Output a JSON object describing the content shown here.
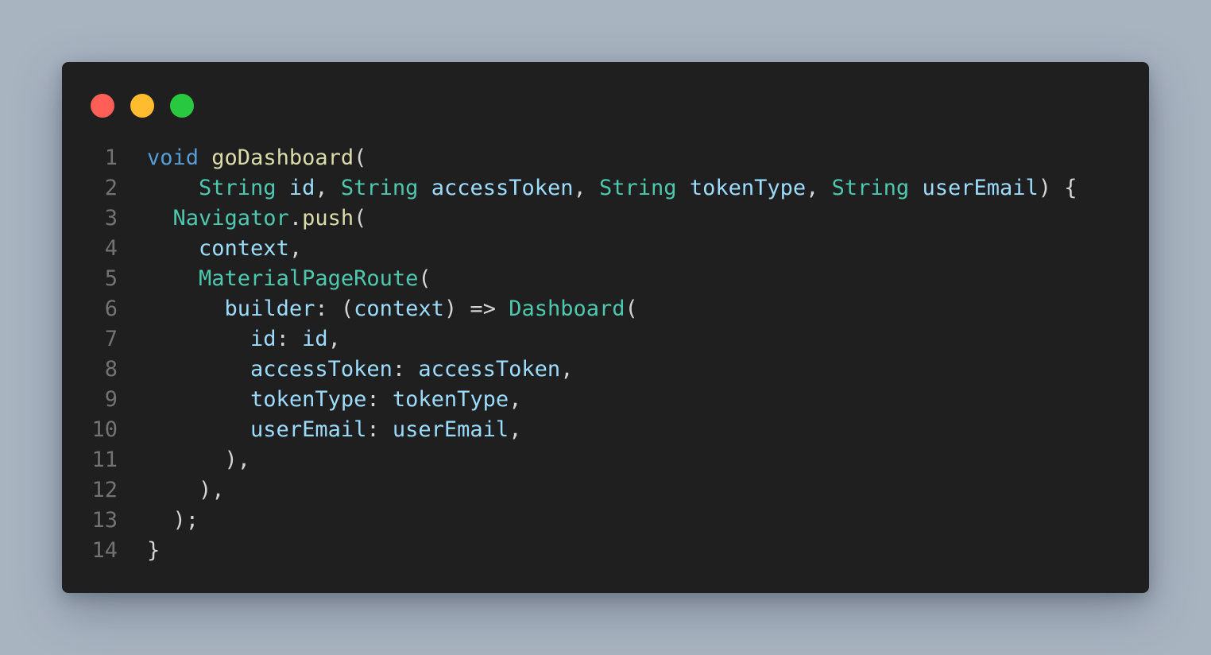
{
  "window": {
    "controls": [
      {
        "name": "close",
        "color": "#ff5f57"
      },
      {
        "name": "minimize",
        "color": "#febc2e"
      },
      {
        "name": "maximize",
        "color": "#28c840"
      }
    ]
  },
  "code": {
    "lines": [
      {
        "num": "1",
        "tokens": [
          {
            "t": "void",
            "c": "kw"
          },
          {
            "t": " ",
            "c": "pn"
          },
          {
            "t": "goDashboard",
            "c": "fn"
          },
          {
            "t": "(",
            "c": "pn"
          }
        ]
      },
      {
        "num": "2",
        "tokens": [
          {
            "t": "    ",
            "c": "pn"
          },
          {
            "t": "String",
            "c": "ty"
          },
          {
            "t": " ",
            "c": "pn"
          },
          {
            "t": "id",
            "c": "vr"
          },
          {
            "t": ", ",
            "c": "pn"
          },
          {
            "t": "String",
            "c": "ty"
          },
          {
            "t": " ",
            "c": "pn"
          },
          {
            "t": "accessToken",
            "c": "vr"
          },
          {
            "t": ", ",
            "c": "pn"
          },
          {
            "t": "String",
            "c": "ty"
          },
          {
            "t": " ",
            "c": "pn"
          },
          {
            "t": "tokenType",
            "c": "vr"
          },
          {
            "t": ", ",
            "c": "pn"
          },
          {
            "t": "String",
            "c": "ty"
          },
          {
            "t": " ",
            "c": "pn"
          },
          {
            "t": "userEmail",
            "c": "vr"
          },
          {
            "t": ") {",
            "c": "pn"
          }
        ]
      },
      {
        "num": "3",
        "tokens": [
          {
            "t": "  ",
            "c": "pn"
          },
          {
            "t": "Navigator",
            "c": "ty"
          },
          {
            "t": ".",
            "c": "pn"
          },
          {
            "t": "push",
            "c": "fn"
          },
          {
            "t": "(",
            "c": "pn"
          }
        ]
      },
      {
        "num": "4",
        "tokens": [
          {
            "t": "    ",
            "c": "pn"
          },
          {
            "t": "context",
            "c": "vr"
          },
          {
            "t": ",",
            "c": "pn"
          }
        ]
      },
      {
        "num": "5",
        "tokens": [
          {
            "t": "    ",
            "c": "pn"
          },
          {
            "t": "MaterialPageRoute",
            "c": "ty"
          },
          {
            "t": "(",
            "c": "pn"
          }
        ]
      },
      {
        "num": "6",
        "tokens": [
          {
            "t": "      ",
            "c": "pn"
          },
          {
            "t": "builder",
            "c": "vr"
          },
          {
            "t": ": (",
            "c": "pn"
          },
          {
            "t": "context",
            "c": "vr"
          },
          {
            "t": ") => ",
            "c": "pn"
          },
          {
            "t": "Dashboard",
            "c": "ty"
          },
          {
            "t": "(",
            "c": "pn"
          }
        ]
      },
      {
        "num": "7",
        "tokens": [
          {
            "t": "        ",
            "c": "pn"
          },
          {
            "t": "id",
            "c": "vr"
          },
          {
            "t": ": ",
            "c": "pn"
          },
          {
            "t": "id",
            "c": "vr"
          },
          {
            "t": ",",
            "c": "pn"
          }
        ]
      },
      {
        "num": "8",
        "tokens": [
          {
            "t": "        ",
            "c": "pn"
          },
          {
            "t": "accessToken",
            "c": "vr"
          },
          {
            "t": ": ",
            "c": "pn"
          },
          {
            "t": "accessToken",
            "c": "vr"
          },
          {
            "t": ",",
            "c": "pn"
          }
        ]
      },
      {
        "num": "9",
        "tokens": [
          {
            "t": "        ",
            "c": "pn"
          },
          {
            "t": "tokenType",
            "c": "vr"
          },
          {
            "t": ": ",
            "c": "pn"
          },
          {
            "t": "tokenType",
            "c": "vr"
          },
          {
            "t": ",",
            "c": "pn"
          }
        ]
      },
      {
        "num": "10",
        "tokens": [
          {
            "t": "        ",
            "c": "pn"
          },
          {
            "t": "userEmail",
            "c": "vr"
          },
          {
            "t": ": ",
            "c": "pn"
          },
          {
            "t": "userEmail",
            "c": "vr"
          },
          {
            "t": ",",
            "c": "pn"
          }
        ]
      },
      {
        "num": "11",
        "tokens": [
          {
            "t": "      ",
            "c": "pn"
          },
          {
            "t": "),",
            "c": "pn"
          }
        ]
      },
      {
        "num": "12",
        "tokens": [
          {
            "t": "    ",
            "c": "pn"
          },
          {
            "t": "),",
            "c": "pn"
          }
        ]
      },
      {
        "num": "13",
        "tokens": [
          {
            "t": "  ",
            "c": "pn"
          },
          {
            "t": ");",
            "c": "pn"
          }
        ]
      },
      {
        "num": "14",
        "tokens": [
          {
            "t": "}",
            "c": "pn"
          }
        ]
      }
    ]
  }
}
